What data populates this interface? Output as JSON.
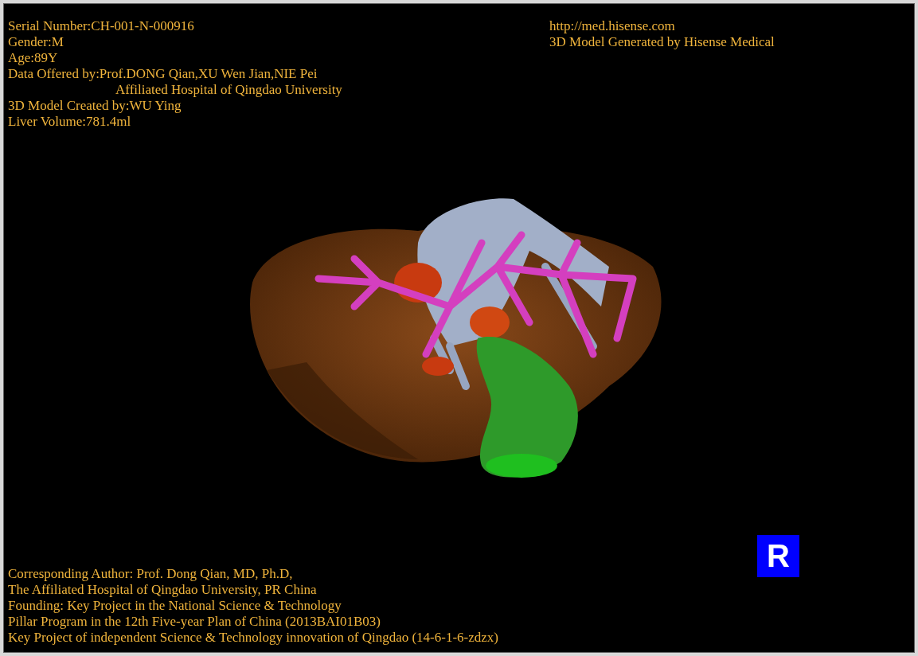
{
  "info_lines": [
    {
      "text": "Serial Number:CH-001-N-000916",
      "kind": "plain"
    },
    {
      "text": "Gender:M",
      "kind": "plain"
    },
    {
      "text": "Age:89Y",
      "kind": "plain"
    },
    {
      "text": "Data Offered by:Prof.DONG Qian,XU Wen Jian,NIE Pei",
      "kind": "plain"
    },
    {
      "text": "Affiliated Hospital of Qingdao University",
      "kind": "indented"
    },
    {
      "text": "3D Model Created by:WU Ying",
      "kind": "plain"
    },
    {
      "text": "Liver Volume:781.4ml",
      "kind": "plain"
    }
  ],
  "credit_lines": [
    "http://med.hisense.com",
    "3D Model Generated by Hisense Medical"
  ],
  "orientation_marker": "R",
  "footer_lines": [
    "Corresponding Author: Prof. Dong Qian, MD, Ph.D,",
    "The Affiliated Hospital of Qingdao University, PR China",
    "Founding: Key Project in the National Science & Technology",
    "Pillar Program in the 12th Five-year Plan of China (2013BAI01B03)",
    "Key Project of independent Science & Technology innovation of Qingdao (14-6-1-6-zdzx)"
  ]
}
